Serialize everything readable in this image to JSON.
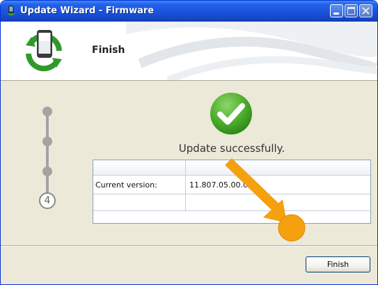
{
  "window": {
    "title": "Update Wizard - Firmware",
    "title_icon": "phone-icon",
    "controls": [
      "minimize-icon",
      "maximize-icon",
      "close-icon"
    ]
  },
  "header": {
    "title": "Finish",
    "icon": "phone-sync-icon"
  },
  "stepper": {
    "current_step": "4",
    "total_steps": 4
  },
  "result": {
    "icon": "checkmark-icon",
    "message": "Update successfully."
  },
  "info_table": {
    "rows": [
      {
        "label": "Current version:",
        "value": "11.807.05.00.00"
      },
      {
        "label": "",
        "value": ""
      }
    ]
  },
  "buttons": {
    "finish_label": "Finish"
  },
  "colors": {
    "titlebar": "#2462e8",
    "success_green": "#47a82a",
    "annotation_orange": "#f5a00f"
  }
}
